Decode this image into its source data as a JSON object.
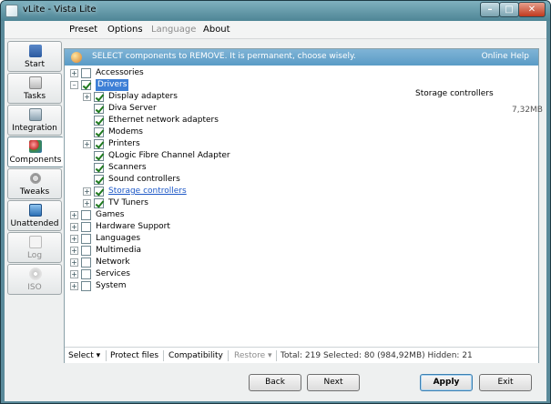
{
  "window": {
    "title": "vLite - Vista Lite"
  },
  "menu": {
    "items": [
      "Preset",
      "Options",
      "Language",
      "About"
    ]
  },
  "sidebar": {
    "items": [
      {
        "label": "Start"
      },
      {
        "label": "Tasks"
      },
      {
        "label": "Integration"
      },
      {
        "label": "Components"
      },
      {
        "label": "Tweaks"
      },
      {
        "label": "Unattended"
      },
      {
        "label": "Log"
      },
      {
        "label": "ISO"
      }
    ]
  },
  "banner": {
    "text": "SELECT components to REMOVE. It is permanent, choose wisely.",
    "help": "Online Help"
  },
  "tree": {
    "accessories": "Accessories",
    "drivers": "Drivers",
    "children": [
      "Display adapters",
      "Diva Server",
      "Ethernet network adapters",
      "Modems",
      "Printers",
      "QLogic Fibre Channel Adapter",
      "Scanners",
      "Sound controllers",
      "Storage controllers",
      "TV Tuners"
    ],
    "bottom": [
      "Games",
      "Hardware Support",
      "Languages",
      "Multimedia",
      "Network",
      "Services",
      "System"
    ]
  },
  "detail": {
    "title": "Storage controllers",
    "size": "7,32MB"
  },
  "status": {
    "select": "Select",
    "protect": "Protect files",
    "compat": "Compatibility",
    "restore": "Restore",
    "stats": "Total: 219  Selected: 80 (984,92MB)  Hidden: 21"
  },
  "buttons": {
    "back": "Back",
    "next": "Next",
    "apply": "Apply",
    "exit": "Exit"
  },
  "icons": {
    "window": "app-icon",
    "banner": "components-icon"
  }
}
